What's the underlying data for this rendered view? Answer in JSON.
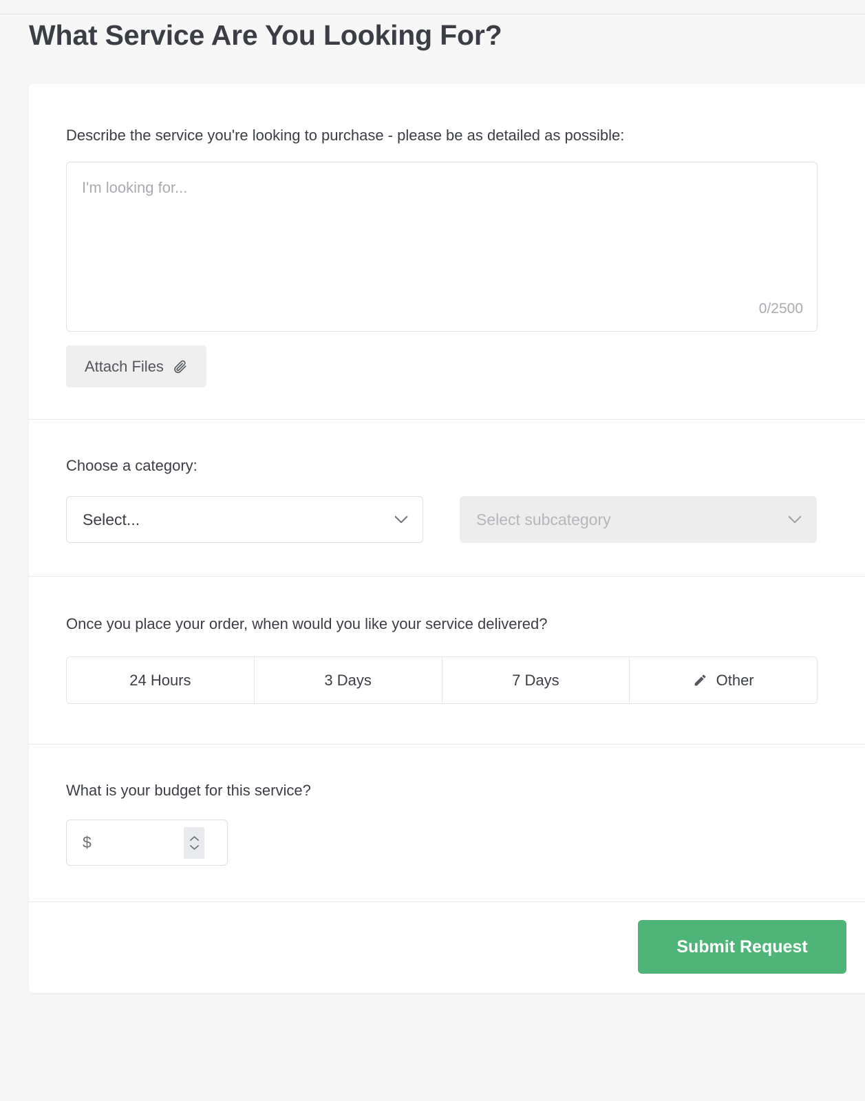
{
  "header": {
    "title": "What Service Are You Looking For?"
  },
  "describe": {
    "label": "Describe the service you're looking to purchase - please be as detailed as possible:",
    "textarea_value": "",
    "textarea_placeholder": "I'm looking for...",
    "char_counter": "0/2500",
    "attach_label": "Attach Files",
    "attach_icon": "paperclip-icon"
  },
  "category": {
    "label": "Choose a category:",
    "primary": {
      "value": "Select...",
      "icon": "chevron-down-icon",
      "disabled": false
    },
    "subcategory": {
      "value": "Select subcategory",
      "icon": "chevron-down-icon",
      "disabled": true
    }
  },
  "delivery": {
    "label": "Once you place your order, when would you like your service delivered?",
    "options": [
      {
        "label": "24 Hours",
        "icon": ""
      },
      {
        "label": "3 Days",
        "icon": ""
      },
      {
        "label": "7 Days",
        "icon": ""
      },
      {
        "label": "Other",
        "icon": "pencil-icon"
      }
    ],
    "selected": ""
  },
  "budget": {
    "label": "What is your budget for this service?",
    "currency_symbol": "$",
    "value": "",
    "stepper_icon": "stepper-up-down-icon"
  },
  "footer": {
    "submit_label": "Submit Request"
  },
  "colors": {
    "page_background": "#f7f7f8",
    "card_background": "#ffffff",
    "text_primary": "#3b3f45",
    "text_muted": "#a8abb0",
    "border": "#e0e1e3",
    "divider": "#ebebed",
    "disabled_background": "#ededed",
    "attach_background": "#efefef",
    "submit_green": "#4fb477"
  }
}
